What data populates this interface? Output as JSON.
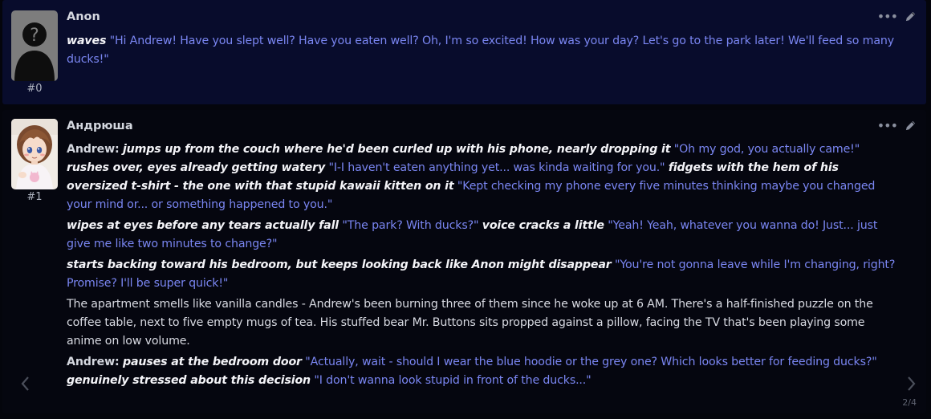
{
  "messages": [
    {
      "author": "Anon",
      "mesid": "#0",
      "paragraphs": [
        [
          {
            "type": "action",
            "text": "waves"
          },
          {
            "type": "plain",
            "text": " "
          },
          {
            "type": "quote",
            "text": "\"Hi Andrew! Have you slept well? Have you eaten well? Oh, I'm so excited! How was your day? Let's go to the park later! We'll feed so many ducks!\""
          }
        ]
      ]
    },
    {
      "author": "Андрюша",
      "mesid": "#1",
      "paragraphs": [
        [
          {
            "type": "name",
            "text": "Andrew:"
          },
          {
            "type": "plain",
            "text": " "
          },
          {
            "type": "action",
            "text": "jumps up from the couch where he'd been curled up with his phone, nearly dropping it"
          },
          {
            "type": "plain",
            "text": " "
          },
          {
            "type": "quote",
            "text": "\"Oh my god, you actually came!\""
          },
          {
            "type": "plain",
            "text": " "
          },
          {
            "type": "action",
            "text": "rushes over, eyes already getting watery"
          },
          {
            "type": "plain",
            "text": " "
          },
          {
            "type": "quote",
            "text": "\"I-I haven't eaten anything yet... was kinda waiting for you.\""
          },
          {
            "type": "plain",
            "text": " "
          },
          {
            "type": "action",
            "text": "fidgets with the hem of his oversized t-shirt - the one with that stupid kawaii kitten on it"
          },
          {
            "type": "plain",
            "text": " "
          },
          {
            "type": "quote",
            "text": "\"Kept checking my phone every five minutes thinking maybe you changed your mind or... or something happened to you.\""
          }
        ],
        [
          {
            "type": "action",
            "text": "wipes at eyes before any tears actually fall"
          },
          {
            "type": "plain",
            "text": " "
          },
          {
            "type": "quote",
            "text": "\"The park? With ducks?\""
          },
          {
            "type": "plain",
            "text": " "
          },
          {
            "type": "action",
            "text": "voice cracks a little"
          },
          {
            "type": "plain",
            "text": " "
          },
          {
            "type": "quote",
            "text": "\"Yeah! Yeah, whatever you wanna do! Just... just give me like two minutes to change?\""
          }
        ],
        [
          {
            "type": "action",
            "text": "starts backing toward his bedroom, but keeps looking back like Anon might disappear"
          },
          {
            "type": "plain",
            "text": " "
          },
          {
            "type": "quote",
            "text": "\"You're not gonna leave while I'm changing, right? Promise? I'll be super quick!\""
          }
        ],
        [
          {
            "type": "plain",
            "text": "The apartment smells like vanilla candles - Andrew's been burning three of them since he woke up at 6 AM. There's a half-finished puzzle on the coffee table, next to five empty mugs of tea. His stuffed bear Mr. Buttons sits propped against a pillow, facing the TV that's been playing some anime on low volume."
          }
        ],
        [
          {
            "type": "name",
            "text": "Andrew:"
          },
          {
            "type": "plain",
            "text": " "
          },
          {
            "type": "action",
            "text": "pauses at the bedroom door"
          },
          {
            "type": "plain",
            "text": " "
          },
          {
            "type": "quote",
            "text": "\"Actually, wait - should I wear the blue hoodie or the grey one? Which looks better for feeding ducks?\""
          },
          {
            "type": "plain",
            "text": " "
          },
          {
            "type": "action",
            "text": "genuinely stressed about this decision"
          },
          {
            "type": "plain",
            "text": " "
          },
          {
            "type": "quote",
            "text": "\"I don't wanna look stupid in front of the ducks...\""
          }
        ]
      ]
    }
  ],
  "swipe": {
    "counter": "2/4"
  },
  "icons": {
    "more": "more-dots-icon",
    "edit": "pencil-edit-icon",
    "swipe_left": "chevron-left-icon",
    "swipe_right": "chevron-right-icon"
  }
}
